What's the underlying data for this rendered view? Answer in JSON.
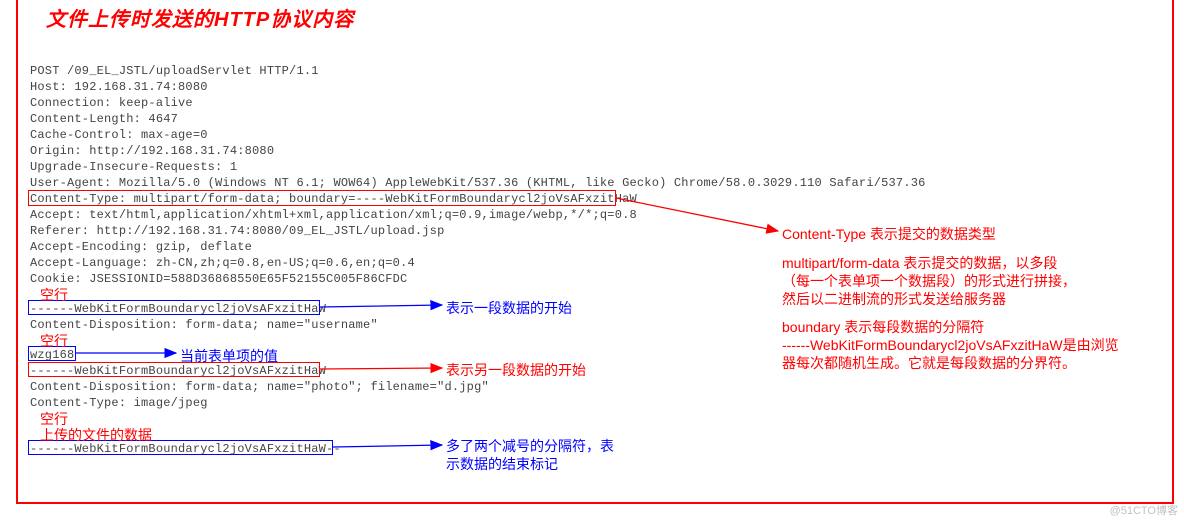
{
  "title": "文件上传时发送的HTTP协议内容",
  "http": {
    "l1": "POST /09_EL_JSTL/uploadServlet HTTP/1.1",
    "l2": "Host: 192.168.31.74:8080",
    "l3": "Connection: keep-alive",
    "l4": "Content-Length: 4647",
    "l5": "Cache-Control: max-age=0",
    "l6": "Origin: http://192.168.31.74:8080",
    "l7": "Upgrade-Insecure-Requests: 1",
    "l8": "User-Agent: Mozilla/5.0 (Windows NT 6.1; WOW64) AppleWebKit/537.36 (KHTML, like Gecko) Chrome/58.0.3029.110 Safari/537.36",
    "l9": "Content-Type: multipart/form-data; boundary=----WebKitFormBoundarycl2joVsAFxzitHaW",
    "l10": "Accept: text/html,application/xhtml+xml,application/xml;q=0.9,image/webp,*/*;q=0.8",
    "l11": "Referer: http://192.168.31.74:8080/09_EL_JSTL/upload.jsp",
    "l12": "Accept-Encoding: gzip, deflate",
    "l13": "Accept-Language: zh-CN,zh;q=0.8,en-US;q=0.6,en;q=0.4",
    "l14": "Cookie: JSESSIONID=588D36868550E65F52155C005F86CFDC",
    "b1": "------WebKitFormBoundarycl2joVsAFxzitHaW",
    "b2": "Content-Disposition: form-data; name=\"username\"",
    "b3": "wzg168",
    "b4": "------WebKitFormBoundarycl2joVsAFxzitHaW",
    "b5": "Content-Disposition: form-data; name=\"photo\"; filename=\"d.jpg\"",
    "b6": "Content-Type: image/jpeg",
    "b7": "------WebKitFormBoundarycl2joVsAFxzitHaW--"
  },
  "ann": {
    "empty1": "空行",
    "empty2": "空行",
    "empty3": "空行",
    "start1": "表示一段数据的开始",
    "curval": "当前表单项的值",
    "start2": "表示另一段数据的开始",
    "filedata": "上传的文件的数据",
    "end1": "多了两个减号的分隔符，表",
    "end2": "示数据的结束标记",
    "right_ct": "Content-Type 表示提交的数据类型",
    "right_mp1": "multipart/form-data 表示提交的数据，以多段",
    "right_mp2": "（每一个表单项一个数据段）的形式进行拼接，",
    "right_mp3": "然后以二进制流的形式发送给服务器",
    "right_bd1": "boundary 表示每段数据的分隔符",
    "right_bd2": "------WebKitFormBoundarycl2joVsAFxzitHaW是由浏览",
    "right_bd3": "器每次都随机生成。它就是每段数据的分界符。"
  },
  "watermark": "@51CTO博客"
}
